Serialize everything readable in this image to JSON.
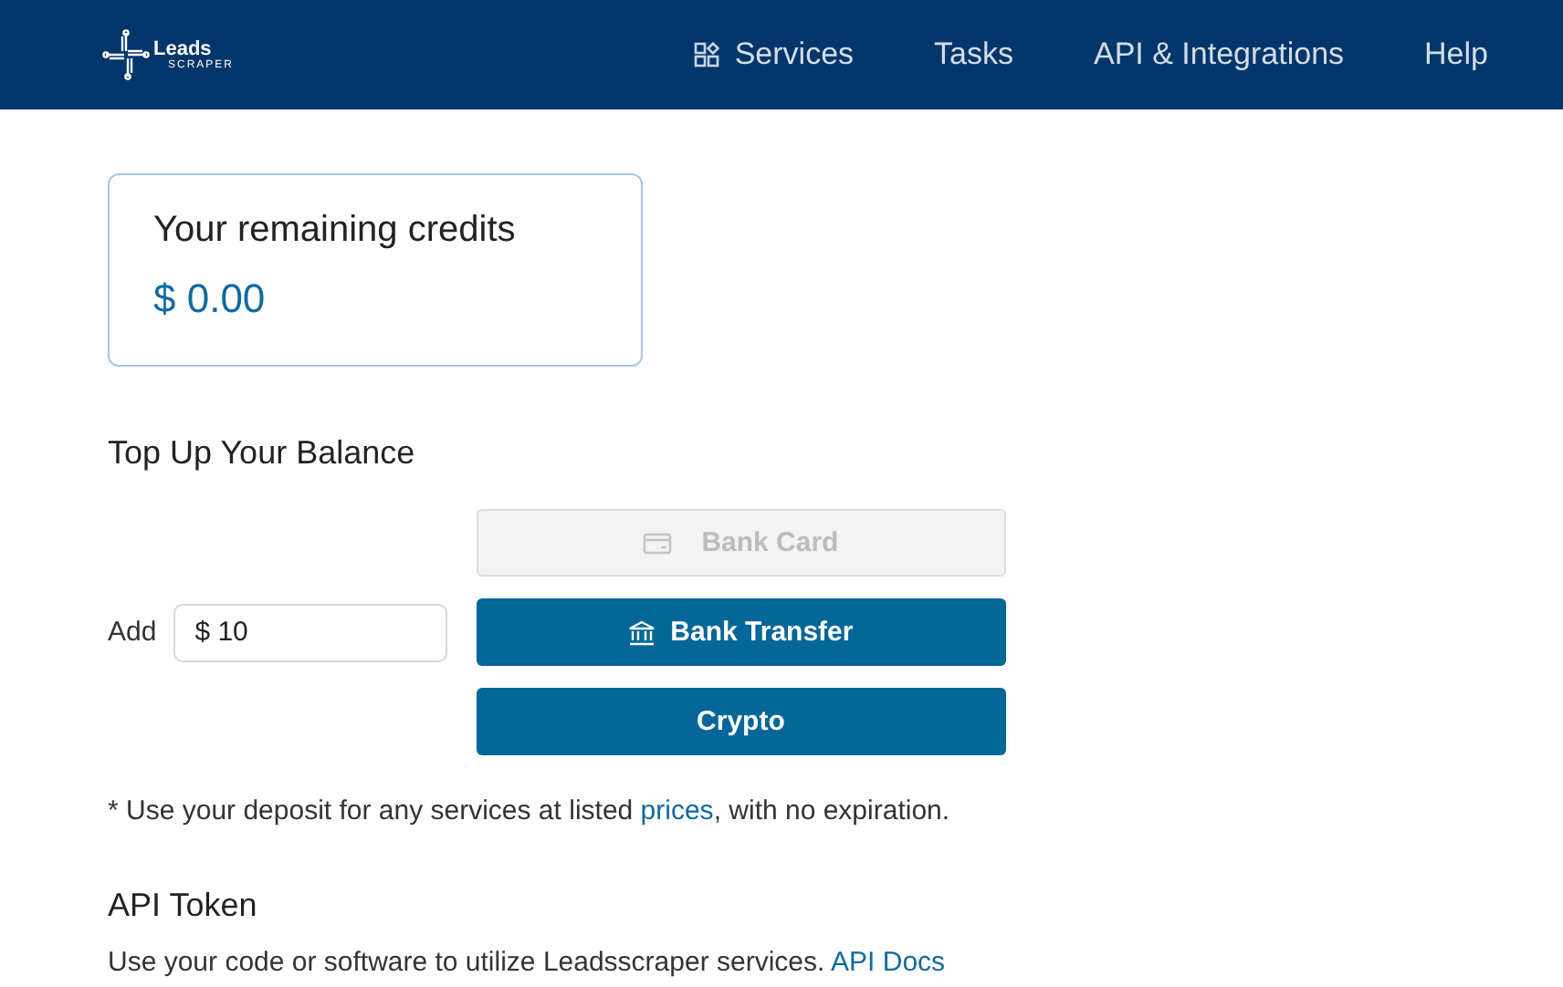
{
  "header": {
    "logo": {
      "top": "Leads",
      "bottom": "SCRAPER"
    },
    "nav": [
      {
        "label": "Services",
        "kind": "grid"
      },
      {
        "label": "Tasks"
      },
      {
        "label": "API & Integrations"
      },
      {
        "label": "Help"
      }
    ]
  },
  "credits": {
    "title": "Your remaining credits",
    "amount": "$ 0.00"
  },
  "top_up": {
    "title": "Top Up Your Balance",
    "add_label": "Add",
    "amount_value": "$ 10",
    "methods": [
      {
        "label": "Bank Card",
        "kind": "card",
        "disabled": true
      },
      {
        "label": "Bank Transfer",
        "kind": "bank",
        "disabled": false
      },
      {
        "label": "Crypto",
        "kind": "plain",
        "disabled": false
      }
    ],
    "note": {
      "before": "* Use your deposit for any services at listed ",
      "link": "prices",
      "after": ", with no expiration."
    }
  },
  "api_token": {
    "title": "API Token",
    "text": "Use your code or software to utilize Leadsscraper services.",
    "link": "API Docs"
  }
}
